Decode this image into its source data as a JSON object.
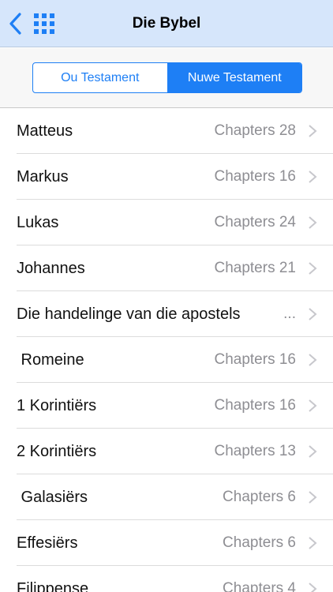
{
  "navbar": {
    "title": "Die Bybel",
    "back_icon": "chevron-left-icon",
    "grid_icon": "grid-icon",
    "accent": "#1e7ff5",
    "background": "#d6e6fb"
  },
  "segment": {
    "items": [
      {
        "label": "Ou Testament",
        "selected": false
      },
      {
        "label": "Nuwe Testament",
        "selected": true
      }
    ]
  },
  "books": [
    {
      "title": "Matteus",
      "detail": "Chapters 28"
    },
    {
      "title": "Markus",
      "detail": "Chapters 16"
    },
    {
      "title": "Lukas",
      "detail": "Chapters 24"
    },
    {
      "title": "Johannes",
      "detail": "Chapters 21"
    },
    {
      "title": "Die handelinge van die apostels",
      "detail": "..."
    },
    {
      "title": " Romeine",
      "detail": "Chapters 16"
    },
    {
      "title": "1 Korintiërs",
      "detail": "Chapters 16"
    },
    {
      "title": "2 Korintiërs",
      "detail": "Chapters 13"
    },
    {
      "title": " Galasiërs",
      "detail": "Chapters 6"
    },
    {
      "title": "Effesiërs",
      "detail": "Chapters 6"
    },
    {
      "title": "Filippense",
      "detail": "Chapters 4"
    }
  ]
}
